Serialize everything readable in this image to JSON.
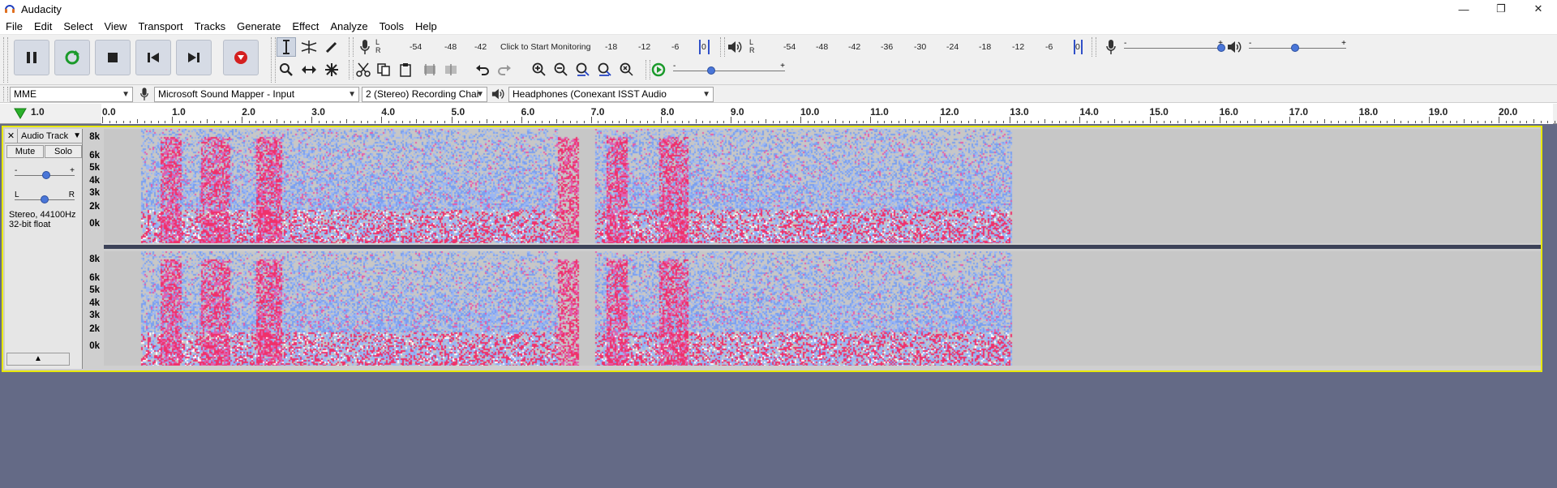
{
  "window": {
    "title": "Audacity",
    "minimize": "—",
    "restore": "❐",
    "close": "✕"
  },
  "menu": [
    "File",
    "Edit",
    "Select",
    "View",
    "Transport",
    "Tracks",
    "Generate",
    "Effect",
    "Analyze",
    "Tools",
    "Help"
  ],
  "transport": {
    "pause": "pause",
    "loop": "loop",
    "stop": "stop",
    "skip_start": "skip-to-start",
    "skip_end": "skip-to-end",
    "record": "record"
  },
  "tools": {
    "row1": [
      "selection-tool",
      "envelope-tool",
      "draw-tool"
    ],
    "row2": [
      "zoom-tool",
      "timeshift-tool",
      "multi-tool"
    ]
  },
  "record_meter": {
    "lr": "L\nR",
    "ticks": [
      "-54",
      "-48",
      "-42",
      "Click to Start Monitoring",
      "-18",
      "-12",
      "-6",
      "0"
    ]
  },
  "play_meter": {
    "lr": "L\nR",
    "ticks": [
      "-54",
      "-48",
      "-42",
      "-36",
      "-30",
      "-24",
      "-18",
      "-12",
      "-6",
      "0"
    ]
  },
  "mixer": {
    "minus": "-",
    "plus": "+"
  },
  "device_toolbar": {
    "host": "MME",
    "input": "Microsoft Sound Mapper - Input",
    "channels": "2 (Stereo) Recording Chai",
    "output": "Headphones (Conexant ISST Audio"
  },
  "ruler": {
    "left_label": "1.0",
    "ticks": [
      "0.0",
      "1.0",
      "2.0",
      "3.0",
      "4.0",
      "5.0",
      "6.0",
      "7.0",
      "8.0",
      "9.0",
      "10.0",
      "11.0",
      "12.0",
      "13.0",
      "14.0",
      "15.0",
      "16.0",
      "17.0",
      "18.0",
      "19.0",
      "20.0"
    ]
  },
  "track": {
    "close": "✕",
    "name": "Audio Track",
    "mute": "Mute",
    "solo": "Solo",
    "gain_minus": "-",
    "gain_plus": "+",
    "pan_left": "L",
    "pan_right": "R",
    "info_line1": "Stereo, 44100Hz",
    "info_line2": "32-bit float",
    "collapse": "▲",
    "vscale": [
      "8k",
      "6k",
      "5k",
      "4k",
      "3k",
      "2k",
      "0k"
    ]
  },
  "colors": {
    "background": "#646a86",
    "selection_border": "#e8e800",
    "spectrogram_blue": "#7aa0f0",
    "spectrogram_pink": "#f0306a"
  }
}
